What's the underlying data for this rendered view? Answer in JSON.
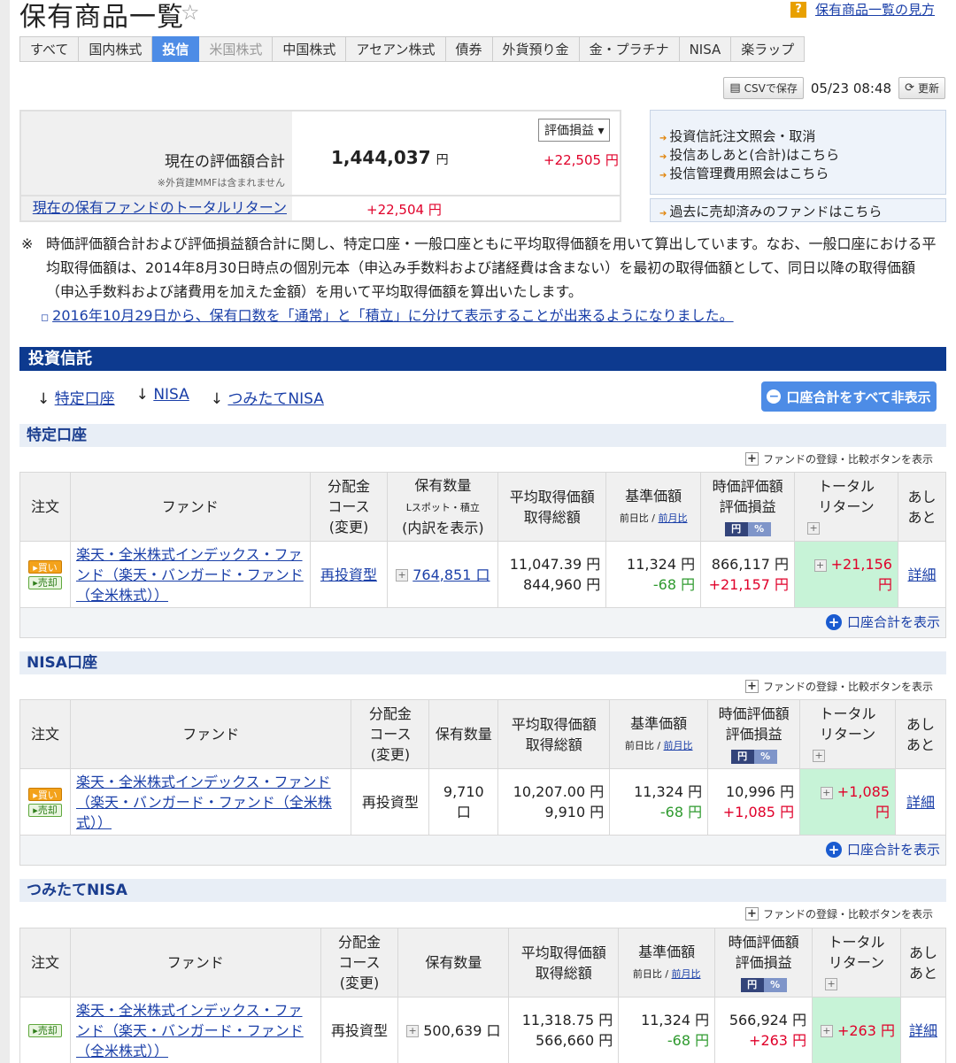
{
  "page": {
    "title": "保有商品一覧",
    "help_link": "保有商品一覧の見方"
  },
  "tabs": [
    {
      "label": "すべて"
    },
    {
      "label": "国内株式"
    },
    {
      "label": "投信"
    },
    {
      "label": "米国株式"
    },
    {
      "label": "中国株式"
    },
    {
      "label": "アセアン株式"
    },
    {
      "label": "債券"
    },
    {
      "label": "外貨預り金"
    },
    {
      "label": "金・プラチナ"
    },
    {
      "label": "NISA"
    },
    {
      "label": "楽ラップ"
    }
  ],
  "toolbar": {
    "csv_label": "CSVで保存",
    "timestamp": "05/23 08:48",
    "refresh_label": "更新"
  },
  "summary": {
    "total_label": "現在の評価額合計",
    "mmf_note": "※外貨建MMFは含まれません",
    "total_value": "1,444,037",
    "yen": "円",
    "select_value": "評価損益",
    "gain": "+22,505 円",
    "return_label": "現在の保有ファンドのトータルリターン",
    "return_value": "+22,504 円"
  },
  "side_links": {
    "l1": "投資信託注文照会・取消",
    "l2": "投信あしあと(合計)はこちら",
    "l3": "投信管理費用照会はこちら",
    "l4": "過去に売却済みのファンドはこちら"
  },
  "note": {
    "mark": "※",
    "text": "時価評価額合計および評価損益額合計に関し、特定口座・一般口座ともに平均取得価額を用いて算出しています。なお、一般口座における平均取得価額は、2014年8月30日時点の個別元本（申込み手数料および諸経費は含まない）を最初の取得価額として、同日以降の取得価額（申込手数料および諸費用を加えた金額）を用いて平均取得価額を算出いたします。",
    "link": "2016年10月29日から、保有口数を「通常」と「積立」に分けて表示することが出来るようになりました。"
  },
  "section": {
    "title": "投資信託",
    "anchor1": "特定口座",
    "anchor2": "NISA",
    "anchor3": "つみたてNISA",
    "hide_all": "口座合計をすべて非表示",
    "register_label": "ファンドの登録・比較ボタンを表示",
    "show_total": "口座合計を表示"
  },
  "headers": {
    "order": "注文",
    "fund": "ファンド",
    "course1": "分配金",
    "course2": "コース",
    "course3": "(変更)",
    "qty": "保有数量",
    "qty_sub": "Lスポット・積立",
    "qty_detail": "(内訳を表示)",
    "avg1": "平均取得価額",
    "avg2": "取得総額",
    "nav1": "基準価額",
    "nav2a": "前日比 / ",
    "nav2b": "前月比",
    "val1": "時価評価額",
    "val2": "評価損益",
    "yen_btn": "円",
    "pct_btn": "%",
    "tr1": "トータル",
    "tr2": "リターン",
    "ashi1": "あし",
    "ashi2": "あと",
    "buy": "買い",
    "sell": "売却",
    "detail": "詳細"
  },
  "accounts": [
    {
      "name": "特定口座",
      "fund": "楽天・全米株式インデックス・ファンド（楽天・バンガード・ファンド（全米株式））",
      "course": "再投資型",
      "qty": "764,851 口",
      "avg_price": "11,047.39 円",
      "total_cost": "844,960 円",
      "nav": "11,324 円",
      "nav_change": "-68 円",
      "market_value": "866,117 円",
      "gain": "+21,157 円",
      "total_return": "+21,156 円"
    },
    {
      "name": "NISA口座",
      "fund": "楽天・全米株式インデックス・ファンド（楽天・バンガード・ファンド（全米株式））",
      "course": "再投資型",
      "qty": "9,710 口",
      "avg_price": "10,207.00 円",
      "total_cost": "9,910 円",
      "nav": "11,324 円",
      "nav_change": "-68 円",
      "market_value": "10,996 円",
      "gain": "+1,085 円",
      "total_return": "+1,085 円"
    },
    {
      "name": "つみたてNISA",
      "fund": "楽天・全米株式インデックス・ファンド（楽天・バンガード・ファンド（全米株式））",
      "course": "再投資型",
      "qty": "500,639 口",
      "avg_price": "11,318.75 円",
      "total_cost": "566,660 円",
      "nav": "11,324 円",
      "nav_change": "-68 円",
      "market_value": "566,924 円",
      "gain": "+263 円",
      "total_return": "+263 円"
    }
  ]
}
